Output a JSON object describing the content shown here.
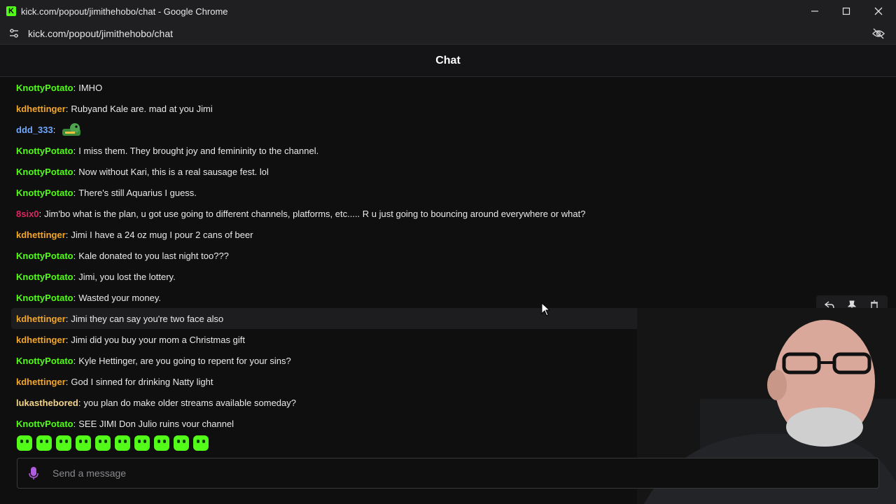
{
  "window": {
    "title": "kick.com/popout/jimithehobo/chat - Google Chrome",
    "url": "kick.com/popout/jimithehobo/chat",
    "favicon_letter": "K"
  },
  "chat": {
    "header": "Chat",
    "messages": [
      {
        "user": "KnottyPotato",
        "color": "#53fc18",
        "text": "IMHO"
      },
      {
        "user": "kdhettinger",
        "color": "#f5a623",
        "text": "Rubyand Kale are. mad at you Jimi"
      },
      {
        "user": "ddd_333",
        "color": "#6fa8ff",
        "text": "",
        "emote": "crocodile-emote"
      },
      {
        "user": "KnottyPotato",
        "color": "#53fc18",
        "text": "I miss them. They brought joy and femininity to the channel."
      },
      {
        "user": "KnottyPotato",
        "color": "#53fc18",
        "text": "Now without Kari, this is a real sausage fest. lol"
      },
      {
        "user": "KnottyPotato",
        "color": "#53fc18",
        "text": "There's still Aquarius I guess."
      },
      {
        "user": "8six0",
        "color": "#e0245e",
        "text": "Jim'bo what is the plan, u got use going to different channels, platforms, etc..... R u just going to bouncing around everywhere or what?"
      },
      {
        "user": "kdhettinger",
        "color": "#f5a623",
        "text": "Jimi I have a 24 oz mug I pour 2 cans of beer"
      },
      {
        "user": "KnottyPotato",
        "color": "#53fc18",
        "text": "Kale donated to you last night too???"
      },
      {
        "user": "KnottyPotato",
        "color": "#53fc18",
        "text": "Jimi, you lost the lottery."
      },
      {
        "user": "KnottyPotato",
        "color": "#53fc18",
        "text": "Wasted your money."
      },
      {
        "user": "kdhettinger",
        "color": "#f5a623",
        "text": "Jimi they can say you're two face also"
      },
      {
        "user": "kdhettinger",
        "color": "#f5a623",
        "text": "Jimi did you buy your mom a Christmas gift"
      },
      {
        "user": "KnottyPotato",
        "color": "#53fc18",
        "text": "Kyle Hettinger, are you going to repent for your sins?"
      },
      {
        "user": "kdhettinger",
        "color": "#f5a623",
        "text": "God I sinned for drinking Natty light"
      },
      {
        "user": "lukasthebored",
        "color": "#f3d58a",
        "text": "you plan do make older streams available someday?"
      },
      {
        "user": "KnottyPotato",
        "color": "#53fc18",
        "text": "SEE JIMI Don Julio ruins your channel"
      }
    ],
    "input_placeholder": "Send a message",
    "emote_count": 10,
    "accent": "#53fc18"
  },
  "icons": {
    "reply": "reply-icon",
    "pin": "pin-icon",
    "delete": "trash-icon",
    "mic": "mic-icon",
    "tune": "tune-icon",
    "eye_off": "eye-off-icon"
  }
}
